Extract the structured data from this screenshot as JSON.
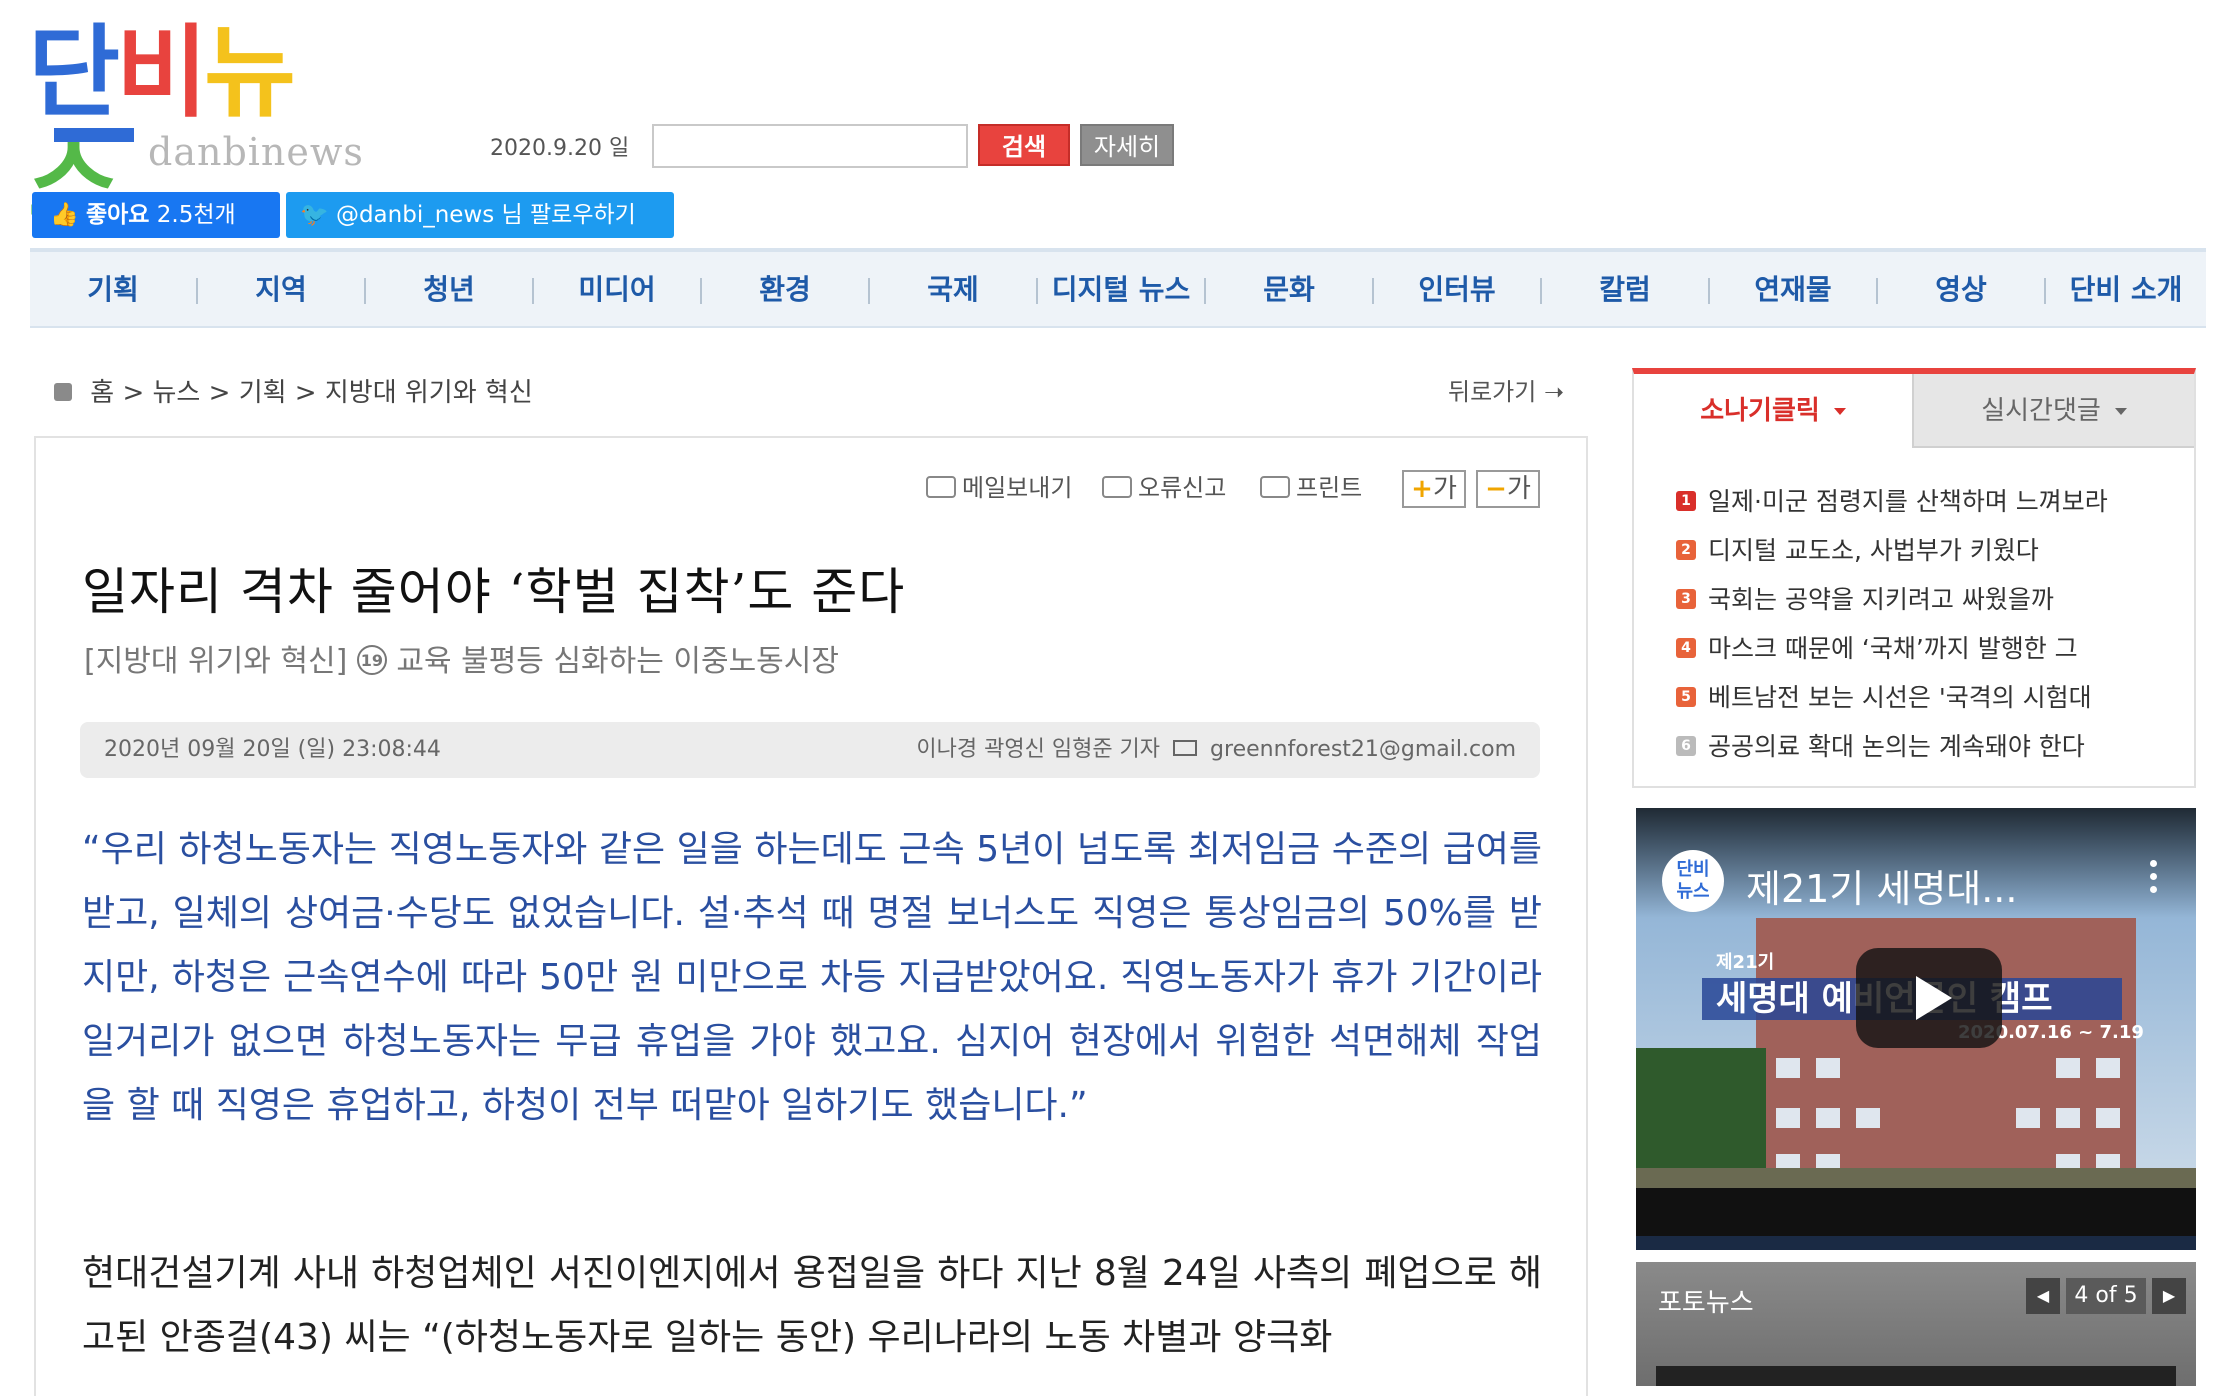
{
  "site": {
    "logo_ko": "단비뉴스",
    "logo_en": "danbinews"
  },
  "header": {
    "date": "2020.9.20 일",
    "search_placeholder": "",
    "search_label": "검색",
    "detail_label": "자세히",
    "like_label": "좋아요",
    "like_count": "2.5천개",
    "follow_label": "@danbi_news 님 팔로우하기"
  },
  "nav": {
    "items": [
      "기획",
      "지역",
      "청년",
      "미디어",
      "환경",
      "국제",
      "디지털 뉴스",
      "문화",
      "인터뷰",
      "칼럼",
      "연재물",
      "영상",
      "단비 소개"
    ]
  },
  "breadcrumb": {
    "home": "홈",
    "news": "뉴스",
    "section": "기획",
    "series": "지방대 위기와 혁신",
    "sep": ">",
    "back": "뒤로가기"
  },
  "tools": {
    "mail": "메일보내기",
    "report": "오류신고",
    "print": "프린트",
    "font_up": "가",
    "font_down": "가"
  },
  "article": {
    "headline": "일자리 격차 줄어야 ‘학벌 집착’도 준다",
    "subhead_prefix": "[지방대 위기와 혁신]",
    "subhead_num": "19",
    "subhead_text": "교육 불평등 심화하는 이중노동시장",
    "datetime": "2020년 09월 20일 (일) 23:08:44",
    "authors": "이나경 곽영신 임형준 기자",
    "email": "greennforest21@gmail.com",
    "quote": "“우리 하청노동자는 직영노동자와 같은 일을 하는데도 근속 5년이 넘도록 최저임금 수준의 급여를 받고, 일체의 상여금·수당도 없었습니다. 설·추석 때 명절 보너스도 직영은 통상임금의 50%를 받지만, 하청은 근속연수에 따라 50만 원 미만으로 차등 지급받았어요. 직영노동자가 휴가 기간이라 일거리가 없으면 하청노동자는 무급 휴업을 가야 했고요. 심지어 현장에서 위험한 석면해체 작업을 할 때 직영은 휴업하고, 하청이 전부 떠맡아 일하기도 했습니다.”",
    "body1": "현대건설기계 사내 하청업체인 서진이엔지에서 용접일을 하다 지난 8월 24일 사측의 폐업으로 해고된 안종걸(43) 씨는 “(하청노동자로 일하는 동안) 우리나라의 노동 차별과 양극화"
  },
  "sidebar": {
    "tab_click": "소나기클릭",
    "tab_comments": "실시간댓글",
    "rank_items": [
      {
        "num": "1",
        "title": "일제·미군 점령지를 산책하며 느껴보라"
      },
      {
        "num": "2",
        "title": "디지털 교도소, 사법부가 키웠다"
      },
      {
        "num": "3",
        "title": "국회는 공약을 지키려고 싸웠을까"
      },
      {
        "num": "4",
        "title": "마스크 때문에 ‘국채’까지 발행한 그"
      },
      {
        "num": "5",
        "title": "베트남전 보는 시선은 '국격의 시험대"
      },
      {
        "num": "6",
        "title": "공공의료 확대 논의는 계속돼야 한다"
      }
    ],
    "video": {
      "channel_logo": "단비뉴스",
      "title": "제21기 세명대...",
      "banner": "세명대 예비언론인 캠프",
      "generation": "제21기",
      "dates": "2020.07.16 ~ 7.19"
    },
    "photo_news": {
      "label": "포토뉴스",
      "page": "4 of 5"
    }
  },
  "colors": {
    "accent_red": "#e8433e",
    "nav_blue": "#1e5aa8",
    "quote_blue": "#2a4fa0",
    "facebook": "#1877f2",
    "twitter": "#1d9bf0"
  }
}
